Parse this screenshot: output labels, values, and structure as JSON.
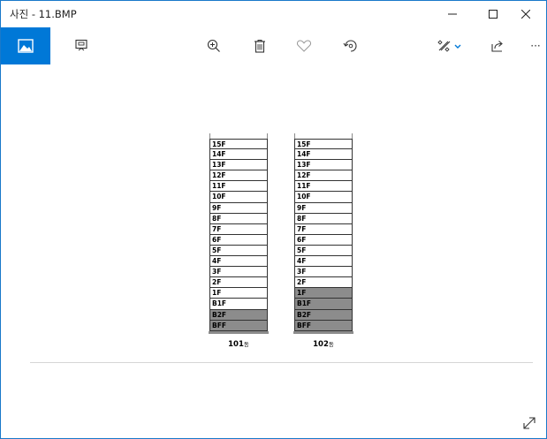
{
  "window": {
    "title": "사진 - 11.BMP",
    "minimize_glyph": "–",
    "maximize_glyph": "□",
    "close_glyph": "✕"
  },
  "toolbar": {
    "items": [
      {
        "name": "image-view",
        "icon": "image-icon",
        "active": true
      },
      {
        "name": "slideshow",
        "icon": "slideshow-icon"
      },
      {
        "name": "zoom",
        "icon": "zoom-in-icon"
      },
      {
        "name": "delete",
        "icon": "trash-icon"
      },
      {
        "name": "favorite",
        "icon": "heart-icon"
      },
      {
        "name": "rotate",
        "icon": "rotate-icon"
      },
      {
        "name": "edit",
        "icon": "edit-create-icon"
      },
      {
        "name": "share",
        "icon": "share-icon"
      },
      {
        "name": "more",
        "icon": "more-icon",
        "label": "···"
      }
    ],
    "accent_color": "#0078d7"
  },
  "image": {
    "buildings": [
      {
        "label": "101",
        "unit": "동",
        "floors": [
          "15F",
          "14F",
          "13F",
          "12F",
          "11F",
          "10F",
          "9F",
          "8F",
          "7F",
          "6F",
          "5F",
          "4F",
          "3F",
          "2F",
          "1F",
          "B1F",
          "B2F",
          "BFF"
        ],
        "shaded_floors": [
          "B2F",
          "BFF"
        ]
      },
      {
        "label": "102",
        "unit": "동",
        "floors": [
          "15F",
          "14F",
          "13F",
          "12F",
          "11F",
          "10F",
          "9F",
          "8F",
          "7F",
          "6F",
          "5F",
          "4F",
          "3F",
          "2F",
          "1F",
          "B1F",
          "B2F",
          "BFF"
        ],
        "shaded_floors": [
          "1F",
          "B1F",
          "B2F",
          "BFF"
        ]
      }
    ],
    "shade_color": "#8c8c8c"
  },
  "footer": {
    "expand_icon": "expand-icon"
  }
}
